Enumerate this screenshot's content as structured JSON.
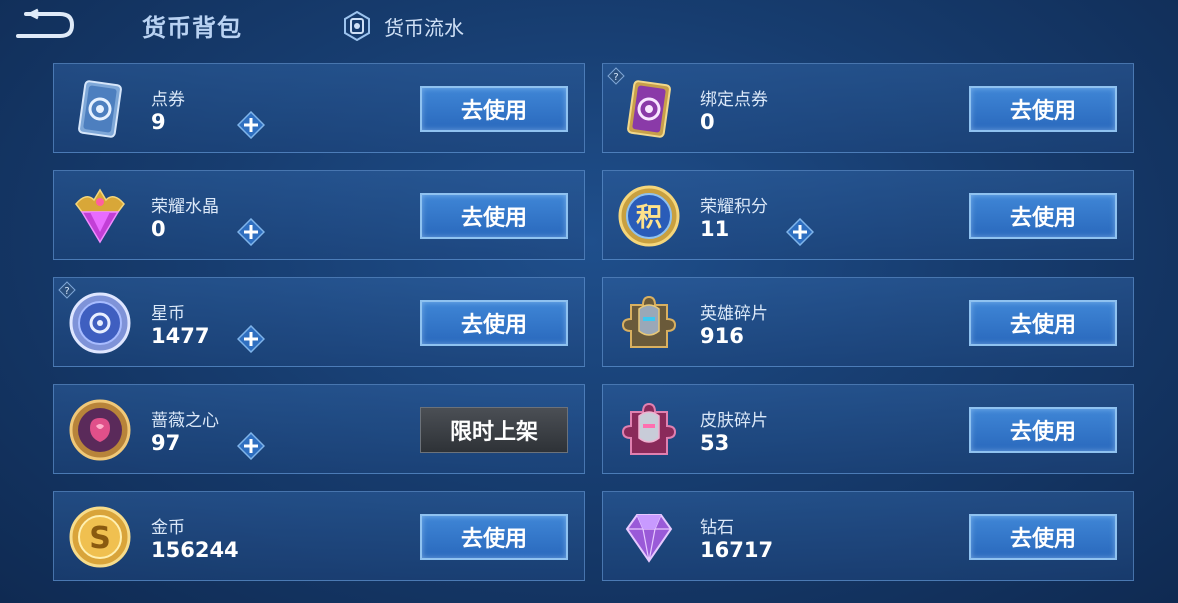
{
  "header": {
    "title": "货币背包",
    "flow_label": "货币流水"
  },
  "colors": {
    "accent": "#2a69bd",
    "button_border": "#8fc2f0",
    "card_border": "#6ea0dc",
    "limited_bg": "#3a3e44"
  },
  "left": [
    {
      "name": "点券",
      "amount": "9",
      "action": "去使用",
      "icon": "voucher-card-icon",
      "plus": true,
      "help": false
    },
    {
      "name": "荣耀水晶",
      "amount": "0",
      "action": "去使用",
      "icon": "glory-crystal-icon",
      "plus": true,
      "help": false
    },
    {
      "name": "星币",
      "amount": "1477",
      "action": "去使用",
      "icon": "star-coin-icon",
      "plus": true,
      "help": true
    },
    {
      "name": "蔷薇之心",
      "amount": "97",
      "action": "限时上架",
      "icon": "rose-heart-icon",
      "plus": true,
      "help": false
    },
    {
      "name": "金币",
      "amount": "156244",
      "action": "去使用",
      "icon": "gold-coin-icon",
      "plus": false,
      "help": false
    }
  ],
  "right": [
    {
      "name": "绑定点券",
      "amount": "0",
      "action": "去使用",
      "icon": "bound-voucher-icon",
      "plus": false,
      "help": true
    },
    {
      "name": "荣耀积分",
      "amount": "11",
      "action": "去使用",
      "icon": "glory-points-icon",
      "plus": true,
      "help": false
    },
    {
      "name": "英雄碎片",
      "amount": "916",
      "action": "去使用",
      "icon": "hero-fragment-icon",
      "plus": false,
      "help": false
    },
    {
      "name": "皮肤碎片",
      "amount": "53",
      "action": "去使用",
      "icon": "skin-fragment-icon",
      "plus": false,
      "help": false
    },
    {
      "name": "钻石",
      "amount": "16717",
      "action": "去使用",
      "icon": "diamond-icon",
      "plus": false,
      "help": false
    }
  ]
}
